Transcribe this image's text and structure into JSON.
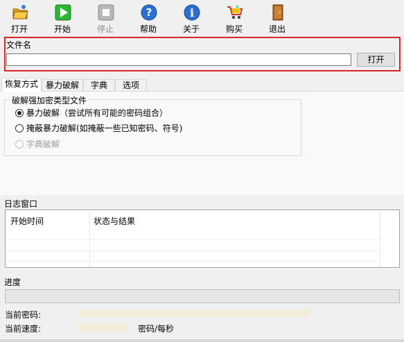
{
  "toolbar": {
    "open": "打开",
    "start": "开始",
    "stop": "停止",
    "help": "帮助",
    "about": "关于",
    "buy": "购买",
    "exit": "退出"
  },
  "file_group": {
    "legend": "文件名",
    "value": "",
    "open_button": "打开"
  },
  "tabs": [
    "恢复方式",
    "暴力破解",
    "字典",
    "选项"
  ],
  "recovery": {
    "legend": "破解强加密类型文件",
    "options": [
      {
        "label": "暴力破解（尝试所有可能的密码组合）",
        "checked": true,
        "disabled": false
      },
      {
        "label": "掩蔽暴力破解(如掩蔽一些已知密码、符号)",
        "checked": false,
        "disabled": false
      },
      {
        "label": "字典破解",
        "checked": false,
        "disabled": true
      }
    ]
  },
  "log": {
    "legend": "日志窗口",
    "columns": [
      "开始时间",
      "状态与结果"
    ]
  },
  "progress": {
    "legend": "进度",
    "value_percent": 0
  },
  "stats": {
    "current_password_label": "当前密码:",
    "current_password_value": "",
    "current_speed_label": "当前速度:",
    "current_speed_value": "",
    "speed_unit": "密码/每秒"
  },
  "colors": {
    "highlight_border": "#d9262a",
    "value_field_bg": "#f3eedb"
  }
}
